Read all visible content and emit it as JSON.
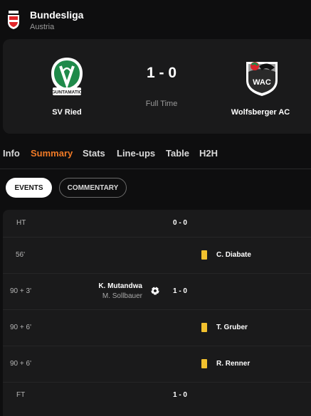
{
  "league": {
    "name": "Bundesliga",
    "country": "Austria"
  },
  "match": {
    "home": {
      "name": "SV Ried",
      "logo_text": "GUNTAMATIC"
    },
    "away": {
      "name": "Wolfsberger AC",
      "logo_text": "WAC"
    },
    "score": "1 - 0",
    "status": "Full Time"
  },
  "tabs": [
    {
      "label": "Info"
    },
    {
      "label": "Summary"
    },
    {
      "label": "Stats"
    },
    {
      "label": "Line-ups"
    },
    {
      "label": "Table"
    },
    {
      "label": "H2H"
    }
  ],
  "active_tab": "Summary",
  "filters": {
    "events": "EVENTS",
    "commentary": "COMMENTARY"
  },
  "events": [
    {
      "minute": "HT",
      "score": "0 - 0"
    },
    {
      "minute": "56'",
      "type": "yellow-card",
      "player": "C. Diabate"
    },
    {
      "minute": "90 + 3'",
      "type": "goal",
      "scorer": "K. Mutandwa",
      "assist": "M. Sollbauer",
      "score": "1 - 0"
    },
    {
      "minute": "90 + 6'",
      "type": "yellow-card",
      "player": "T. Gruber"
    },
    {
      "minute": "90 + 6'",
      "type": "yellow-card",
      "player": "R. Renner"
    },
    {
      "minute": "FT",
      "score": "1 - 0"
    }
  ],
  "colors": {
    "accent": "#f07a26",
    "yellow_card": "#f2c12e",
    "background": "#0e0e0f",
    "card": "#1a1a1b"
  }
}
